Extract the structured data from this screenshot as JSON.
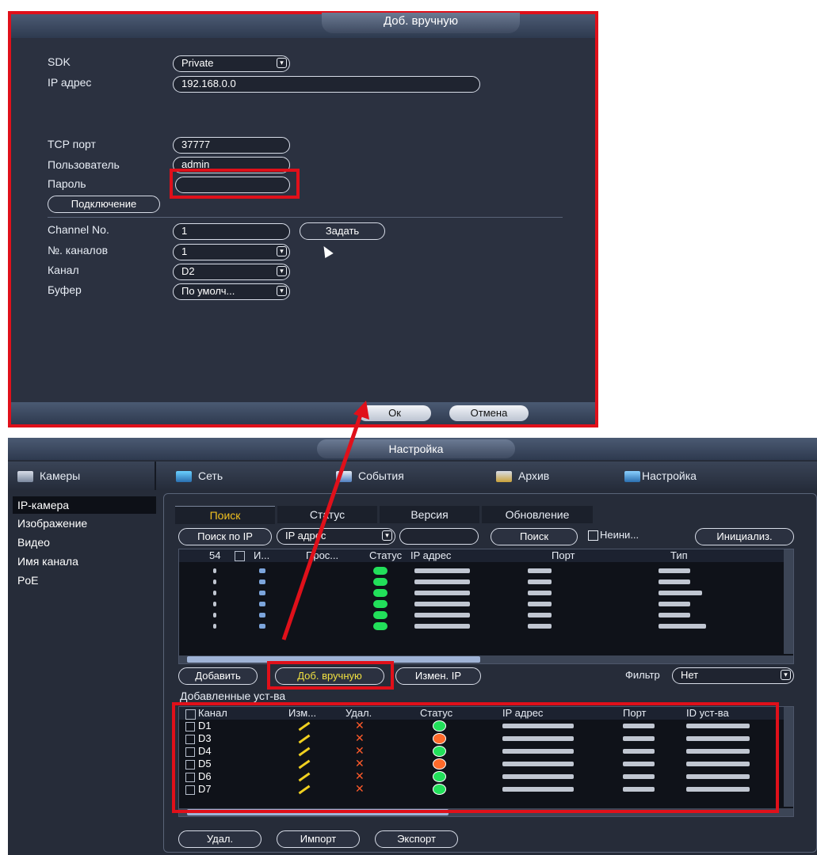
{
  "dialog": {
    "title": "Доб. вручную",
    "sdk_label": "SDK",
    "sdk_value": "Private",
    "ip_label": "IP адрес",
    "ip_value": "192.168.0.0",
    "tcp_label": "TCP порт",
    "tcp_value": "37777",
    "user_label": "Пользователь",
    "user_value": "admin",
    "password_label": "Пароль",
    "password_value": "",
    "connect_button": "Подключение",
    "channel_no_label": "Channel No.",
    "channel_no_value": "1",
    "set_button": "Задать",
    "channels_count_label": "№. каналов",
    "channels_count_value": "1",
    "channel_label": "Канал",
    "channel_value": "D2",
    "buffer_label": "Буфер",
    "buffer_value": "По умолч...",
    "ok_button": "Ок",
    "cancel_button": "Отмена"
  },
  "window": {
    "title": "Настройка",
    "nav": [
      "Камеры",
      "Сеть",
      "События",
      "Архив",
      "Настройка"
    ],
    "sidebar": [
      "IP-камера",
      "Изображение",
      "Видео",
      "Имя канала",
      "PoE"
    ],
    "tabs": [
      "Поиск",
      "Статус",
      "Версия",
      "Обновление"
    ],
    "search_mode": "Поиск по IP",
    "search_field": "IP адрес",
    "search_button": "Поиск",
    "uninit_label": "Неини...",
    "init_button": "Инициализ.",
    "search_grid_headers": [
      "54",
      "И...",
      "Прос...",
      "Статус",
      "IP адрес",
      "Порт",
      "Тип"
    ],
    "add_button": "Добавить",
    "manual_add_button": "Доб. вручную",
    "change_ip_button": "Измен. IP",
    "filter_label": "Фильтр",
    "filter_value": "Нет",
    "added_title": "Добавленные уст-ва",
    "added_headers": [
      "Канал",
      "Изм...",
      "Удал.",
      "Статус",
      "IP адрес",
      "Порт",
      "ID уст-ва"
    ],
    "added_rows": [
      {
        "channel": "D1",
        "status": "online"
      },
      {
        "channel": "D3",
        "status": "offline"
      },
      {
        "channel": "D4",
        "status": "online"
      },
      {
        "channel": "D5",
        "status": "offline"
      },
      {
        "channel": "D6",
        "status": "online"
      },
      {
        "channel": "D7",
        "status": "online"
      }
    ],
    "delete_button": "Удал.",
    "import_button": "Импорт",
    "export_button": "Экспорт"
  },
  "colors": {
    "highlight": "#e0101a",
    "online": "#22e05a",
    "offline": "#ff6a2a",
    "active_tab": "#f0c020"
  }
}
